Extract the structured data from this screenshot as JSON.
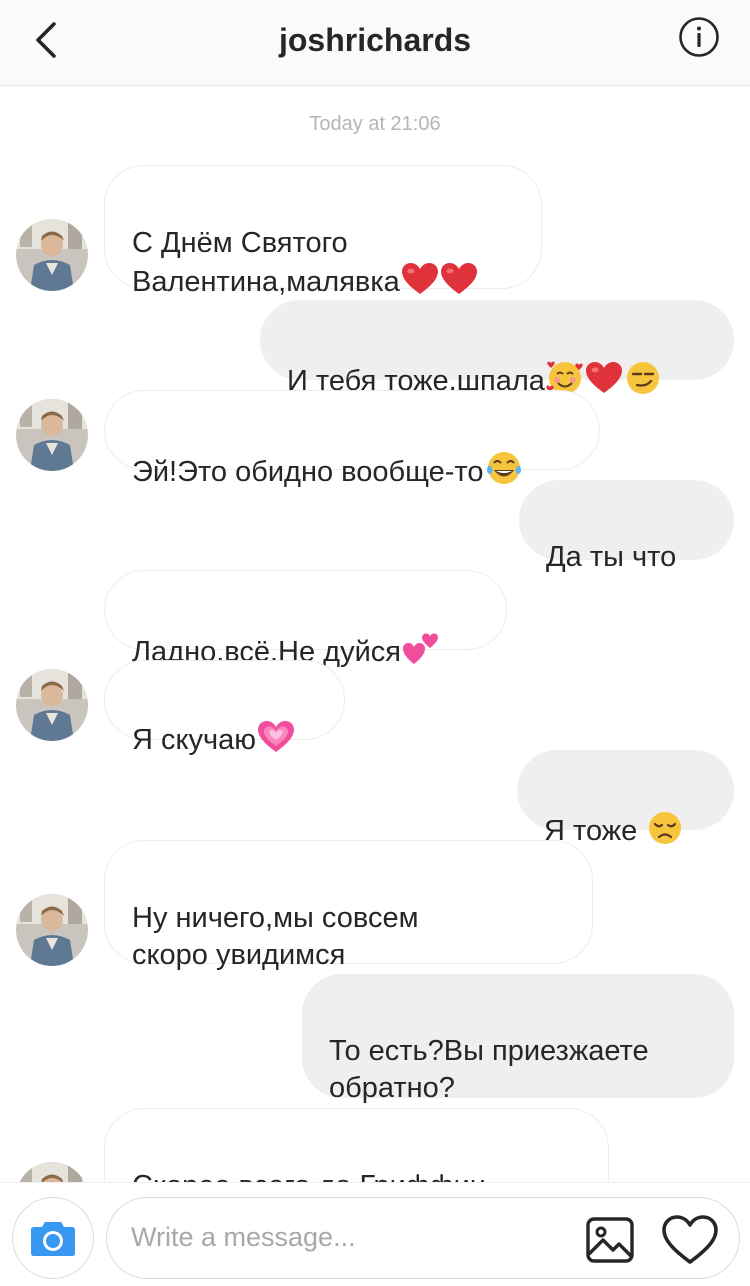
{
  "header": {
    "username": "joshrichards",
    "back_icon": "chevron-left-icon",
    "info_icon": "info-icon"
  },
  "chat": {
    "timestamp": "Today at 21:06",
    "messages": [
      {
        "dir": "in",
        "text": "С Днём Святого\nВалентина,малявка",
        "emoji": [
          "heart",
          "heart"
        ]
      },
      {
        "dir": "out",
        "text": "И тебя тоже,шпала",
        "emoji": [
          "smiling-face-with-hearts",
          "heart",
          "smirk"
        ]
      },
      {
        "dir": "in",
        "text": "Эй!Это обидно вообще-то",
        "emoji": [
          "tears-of-joy"
        ]
      },
      {
        "dir": "out",
        "text": "Да ты что",
        "emoji": []
      },
      {
        "dir": "in",
        "text": "Ладно,всё.Не дуйся",
        "emoji": [
          "two-hearts"
        ]
      },
      {
        "dir": "in",
        "text": "Я скучаю",
        "emoji": [
          "growing-heart"
        ]
      },
      {
        "dir": "out",
        "text": "Я тоже ",
        "emoji": [
          "disappointed"
        ]
      },
      {
        "dir": "in",
        "text": "Ну ничего,мы совсем\nскоро увидимся",
        "emoji": []
      },
      {
        "dir": "out",
        "text": "То есть?Вы приезжаете\nобратно?",
        "emoji": []
      },
      {
        "dir": "in",
        "text": "Скорее всего да.Гриффин",
        "emoji": []
      }
    ]
  },
  "composer": {
    "placeholder": "Write a message...",
    "camera_icon": "camera-icon",
    "gallery_icon": "image-icon",
    "like_icon": "heart-icon"
  },
  "colors": {
    "accent": "#3897f0",
    "incoming_bubble": "#ffffff",
    "outgoing_bubble": "#efefef",
    "timestamp": "#b5b5b5"
  }
}
